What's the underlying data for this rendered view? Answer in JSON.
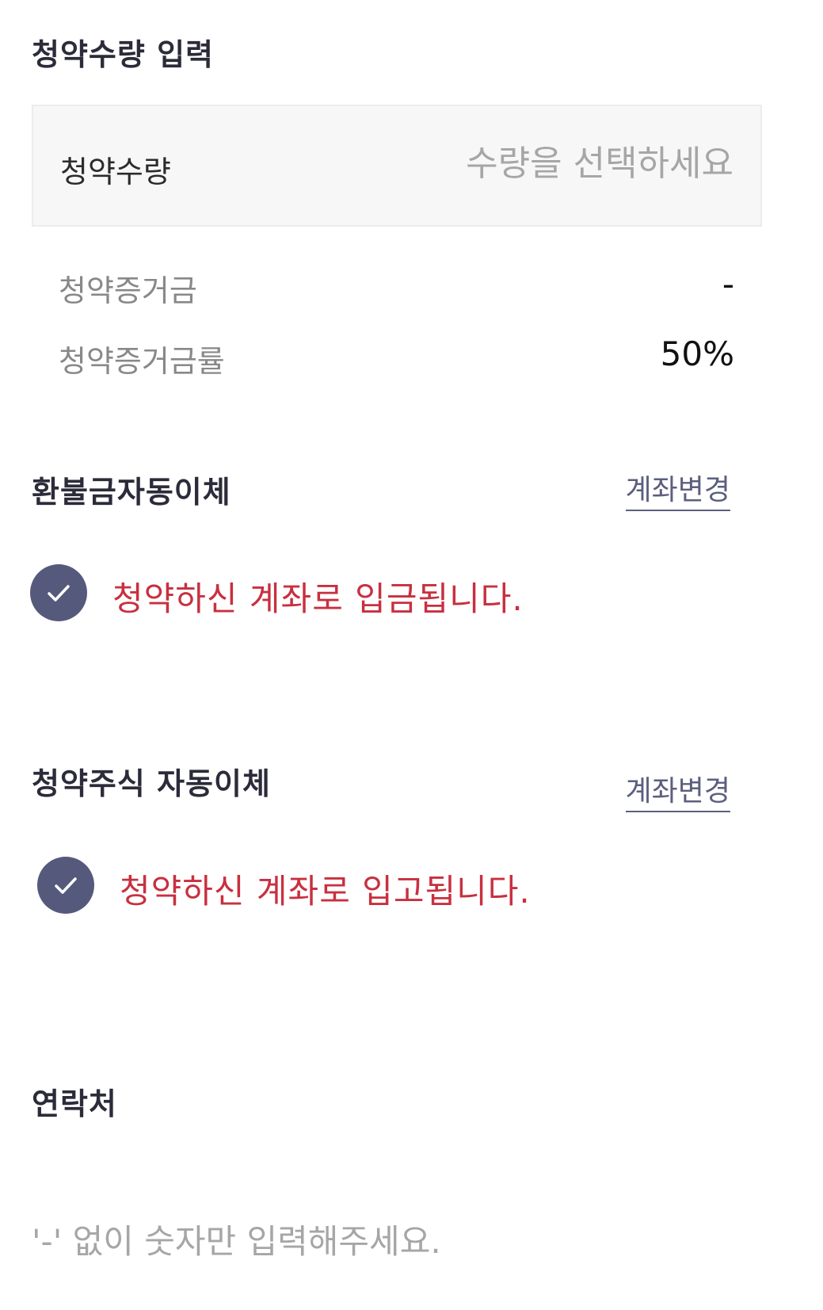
{
  "subscription_quantity": {
    "section_title": "청약수량 입력",
    "field_label": "청약수량",
    "placeholder": "수량을 선택하세요"
  },
  "margin_info": {
    "deposit_label": "청약증거금",
    "deposit_value": "-",
    "rate_label": "청약증거금률",
    "rate_value": "50%"
  },
  "refund_transfer": {
    "title": "환불금자동이체",
    "change_link": "계좌변경",
    "notice": "청약하신 계좌로 입금됩니다."
  },
  "stock_transfer": {
    "title": "청약주식 자동이체",
    "change_link": "계좌변경",
    "notice": "청약하신 계좌로 입고됩니다."
  },
  "contact": {
    "title": "연락처",
    "placeholder": "'-' 없이 숫자만 입력해주세요."
  },
  "colors": {
    "notice_red": "#c8303f",
    "check_circle": "#555a7c",
    "link": "#5b5f7e"
  },
  "icons": {
    "check": "check-icon"
  }
}
